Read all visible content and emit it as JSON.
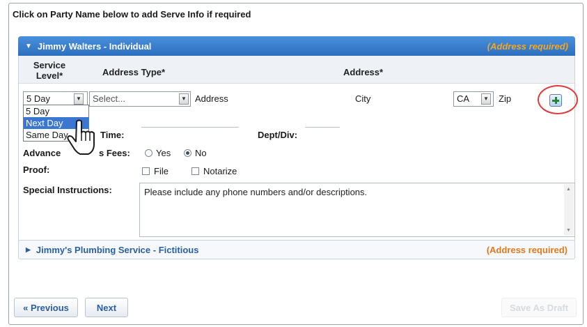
{
  "instructions": "Click on Party Name below to add Serve Info if required",
  "party1": {
    "name": "Jimmy Walters - Individual",
    "required_note": "(Address required)",
    "headers": {
      "service_level": "Service Level*",
      "address_type": "Address Type*",
      "address": "Address*"
    },
    "service_level_value": "5 Day",
    "service_level_options": [
      "5 Day",
      "Next Day",
      "Same Day"
    ],
    "service_level_highlighted": "Next Day",
    "address_type_value": "Select...",
    "address_placeholder": "Address",
    "city_placeholder": "City",
    "state_value": "CA",
    "zip_placeholder": "Zip",
    "time_label": "Time:",
    "dept_label": "Dept/Div:",
    "advance_fees_label": "Advance Witness Fees:",
    "advance_fees_label_visible_a": "Advance",
    "advance_fees_label_visible_b": "s Fees:",
    "fees_yes": "Yes",
    "fees_no": "No",
    "fees_selected": "No",
    "proof_label": "Proof:",
    "proof_file": "File",
    "proof_notarize": "Notarize",
    "special_label": "Special Instructions:",
    "special_text": "Please include any phone numbers and/or descriptions."
  },
  "party2": {
    "name": "Jimmy's Plumbing Service - Fictitious",
    "required_note": "(Address required)"
  },
  "nav": {
    "previous": "« Previous",
    "next": "Next",
    "disabled_action": "Save As Draft"
  },
  "colors": {
    "header_blue": "#2c6fc0",
    "required_orange": "#e07a1f",
    "annotation_red": "#e03a3a"
  }
}
